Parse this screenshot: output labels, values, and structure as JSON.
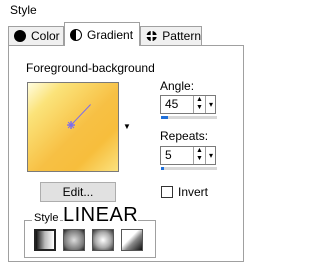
{
  "section": {
    "title": "Style"
  },
  "tabs": [
    {
      "label": "Color",
      "icon": "color-icon",
      "active": false
    },
    {
      "label": "Gradient",
      "icon": "gradient-icon",
      "active": true
    },
    {
      "label": "Pattern",
      "icon": "pattern-icon",
      "active": false
    }
  ],
  "gradient": {
    "preset_label": "Foreground-background",
    "angle": {
      "label": "Angle:",
      "value": "45",
      "fraction": 0.125
    },
    "repeats": {
      "label": "Repeats:",
      "value": "5",
      "fraction": 0.05
    },
    "edit_label": "Edit...",
    "invert_label": "Invert",
    "invert_checked": false,
    "style_legend": "Style",
    "style_name": "LINEAR",
    "style_icons": [
      "linear-style-icon",
      "rectangular-style-icon",
      "sunburst-style-icon",
      "radial-style-icon"
    ],
    "colors": {
      "gold": "#f7c044",
      "light": "#fffde0",
      "handle": "#7b6cf0"
    }
  }
}
